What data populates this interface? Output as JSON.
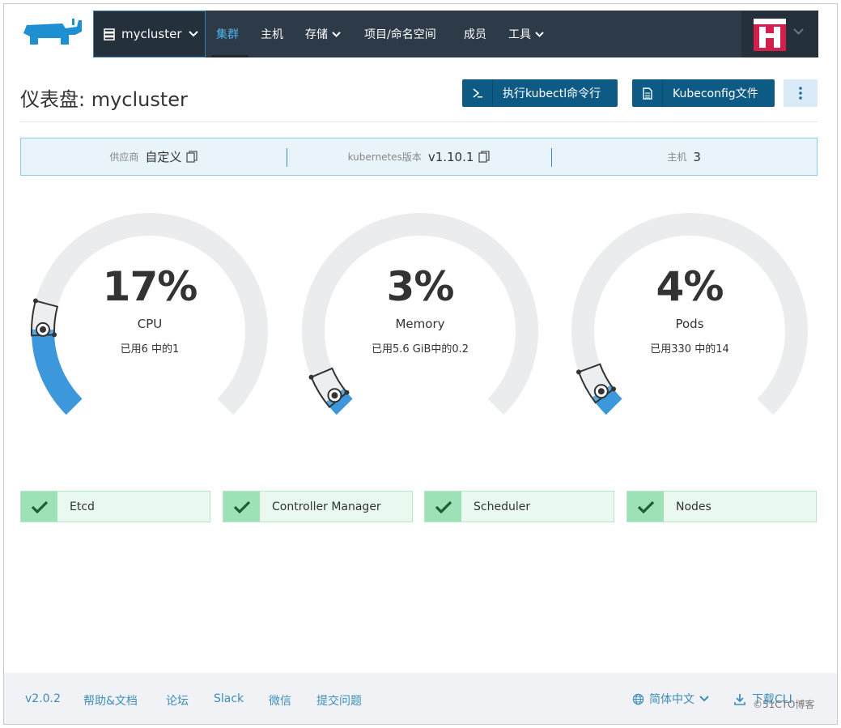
{
  "nav": {
    "cluster_name": "mycluster",
    "items": [
      {
        "label": "集群",
        "active": true,
        "dropdown": false
      },
      {
        "label": "主机",
        "active": false,
        "dropdown": false
      },
      {
        "label": "存储",
        "active": false,
        "dropdown": true
      },
      {
        "label": "项目/命名空间",
        "active": false,
        "dropdown": false
      },
      {
        "label": "成员",
        "active": false,
        "dropdown": false
      },
      {
        "label": "工具",
        "active": false,
        "dropdown": true
      }
    ]
  },
  "page": {
    "title": "仪表盘: mycluster",
    "kubectl_button": "执行kubectl命令行",
    "kubeconfig_button": "Kubeconfig文件"
  },
  "info": {
    "provider_label": "供应商",
    "provider_value": "自定义",
    "k8s_label": "kubernetes版本",
    "k8s_value": "v1.10.1",
    "hosts_label": "主机",
    "hosts_value": "3"
  },
  "gauges": [
    {
      "percent_text": "17%",
      "label": "CPU",
      "usage": "已用6 中的1",
      "fraction": 0.17
    },
    {
      "percent_text": "3%",
      "label": "Memory",
      "usage": "已用5.6 GiB中的0.2",
      "fraction": 0.03
    },
    {
      "percent_text": "4%",
      "label": "Pods",
      "usage": "已用330 中的14",
      "fraction": 0.04
    }
  ],
  "components": [
    {
      "label": "Etcd"
    },
    {
      "label": "Controller Manager"
    },
    {
      "label": "Scheduler"
    },
    {
      "label": "Nodes"
    }
  ],
  "footer": {
    "version": "v2.0.2",
    "help": "帮助&文档",
    "forum": "论坛",
    "slack": "Slack",
    "wechat": "微信",
    "issue": "提交问题",
    "language": "简体中文",
    "download": "下载CLI"
  },
  "watermark": "©51CTO博客",
  "colors": {
    "nav_bg": "#2d3a48",
    "accent": "#4fb3e8",
    "primary_button": "#0d5b85",
    "gauge_fill": "#3d98db",
    "gauge_track": "#eaeced",
    "status_ok": "#9de2b6"
  }
}
